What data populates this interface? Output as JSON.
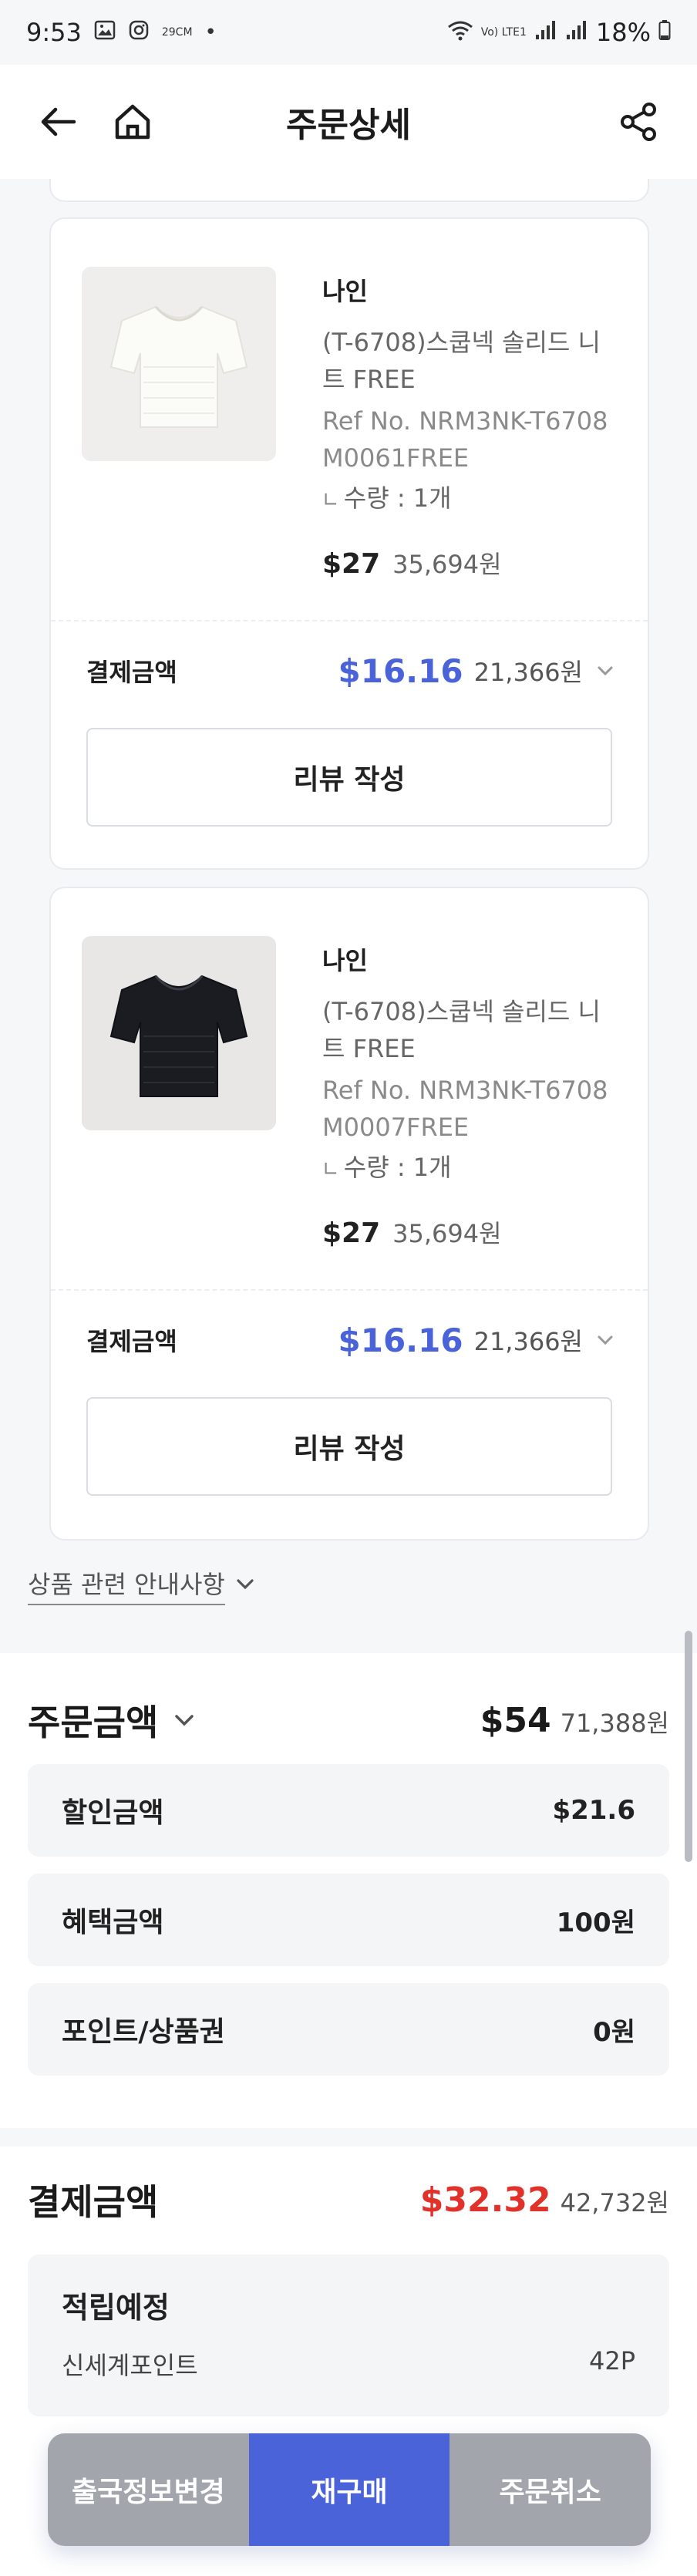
{
  "status_bar": {
    "time": "9:53",
    "temp_badge": "29CM",
    "network_label": "Vo) LTE1",
    "battery": "18%"
  },
  "header": {
    "title": "주문상세"
  },
  "products": [
    {
      "brand": "나인",
      "name": "(T-6708)스쿱넥 솔리드 니트 FREE",
      "ref": "Ref No. NRM3NK-T6708M0061FREE",
      "qty": "수량 : 1개",
      "price_usd": "$27",
      "price_krw": "35,694원",
      "pay_label": "결제금액",
      "pay_usd": "$16.16",
      "pay_krw": "21,366원",
      "review_label": "리뷰 작성",
      "color": "ivory"
    },
    {
      "brand": "나인",
      "name": "(T-6708)스쿱넥 솔리드 니트 FREE",
      "ref": "Ref No. NRM3NK-T6708M0007FREE",
      "qty": "수량 : 1개",
      "price_usd": "$27",
      "price_krw": "35,694원",
      "pay_label": "결제금액",
      "pay_usd": "$16.16",
      "pay_krw": "21,366원",
      "review_label": "리뷰 작성",
      "color": "black"
    }
  ],
  "notice": {
    "label": "상품 관련 안내사항"
  },
  "order_amount": {
    "title": "주문금액",
    "usd": "$54",
    "krw": "71,388원",
    "lines": [
      {
        "label": "할인금액",
        "value": "$21.6"
      },
      {
        "label": "혜택금액",
        "value": "100원"
      },
      {
        "label": "포인트/상품권",
        "value": "0원"
      }
    ]
  },
  "payment": {
    "title": "결제금액",
    "usd": "$32.32",
    "krw": "42,732원",
    "points_title": "적립예정",
    "points_label": "신세계포인트",
    "points_value": "42P"
  },
  "bottom_bar": {
    "change_label": "출국정보변경",
    "reorder_label": "재구매",
    "cancel_label": "주문취소"
  },
  "colors": {
    "accent": "#4a63d8",
    "final_price": "#e0322b",
    "button_gray": "#a2a5ab"
  }
}
